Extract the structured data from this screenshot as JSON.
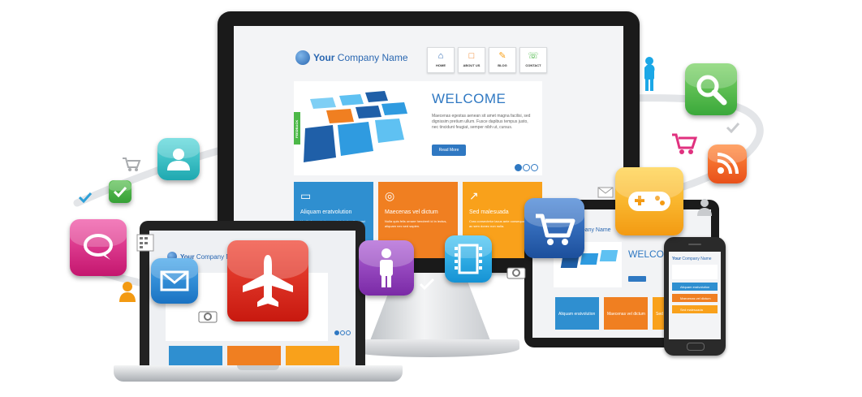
{
  "site": {
    "company_prefix": "Your",
    "company_name": "Company Name",
    "nav": [
      {
        "label": "HOME",
        "icon": "home-icon"
      },
      {
        "label": "ABOUT US",
        "icon": "document-icon"
      },
      {
        "label": "BLOG",
        "icon": "pencil-icon"
      },
      {
        "label": "CONTACT",
        "icon": "phone-icon"
      }
    ],
    "slider": {
      "heading": "WELCOME",
      "body": "Maecenas egestas aenean sit amet magna facilisi, sed dignissim pretium ullum. Fusce dapibus tempus justo, nec tincidunt feugiat, semper nibh ut, cursus.",
      "button": "Read More",
      "feedback_tab": "FEEDBACK"
    },
    "tiles": [
      {
        "title": "Aliquam eratvolution",
        "body": "Vestibulum ante ipsum primis in faucibus orci luctus et ultrices posuere cubilia curae.",
        "color": "#2f8fd0",
        "icon": "chat-icon"
      },
      {
        "title": "Maecenas vel dictum",
        "body": "Nulla quis felis ornare hendrerit id in lectus, aliquam nec sed sapien.",
        "color": "#f07f21",
        "icon": "globe-icon"
      },
      {
        "title": "Sed malesuada",
        "body": "Cras consectetur lacus ante consequat tempor ac sem donec non nulla.",
        "color": "#f9a11b",
        "icon": "chart-icon"
      }
    ]
  },
  "tablet": {
    "company_name": "Company Name",
    "heading": "WELCOME",
    "tiles": [
      "Aliquam eratvolution",
      "Maecenas vel dictum",
      "Sed malesuada"
    ]
  },
  "phone": {
    "company_prefix": "Your",
    "company_name": "Company Name",
    "items": [
      "Aliquam eratvolution",
      "Maecenas vel dictum",
      "Sed malesuada"
    ]
  },
  "icons": {
    "search": {
      "color": "#4cb848"
    },
    "rss": {
      "color": "#f06a22"
    },
    "gamepad": {
      "color": "#f9b21b"
    },
    "cart": {
      "color": "#2b5fb2"
    },
    "video": {
      "color": "#1ba7e6"
    },
    "person": {
      "color": "#8a3fb0"
    },
    "airplane": {
      "color": "#d9251c"
    },
    "mail": {
      "color": "#2a8fd4"
    },
    "chat": {
      "color": "#e0317f"
    },
    "user": {
      "color": "#2ec3c9"
    }
  }
}
